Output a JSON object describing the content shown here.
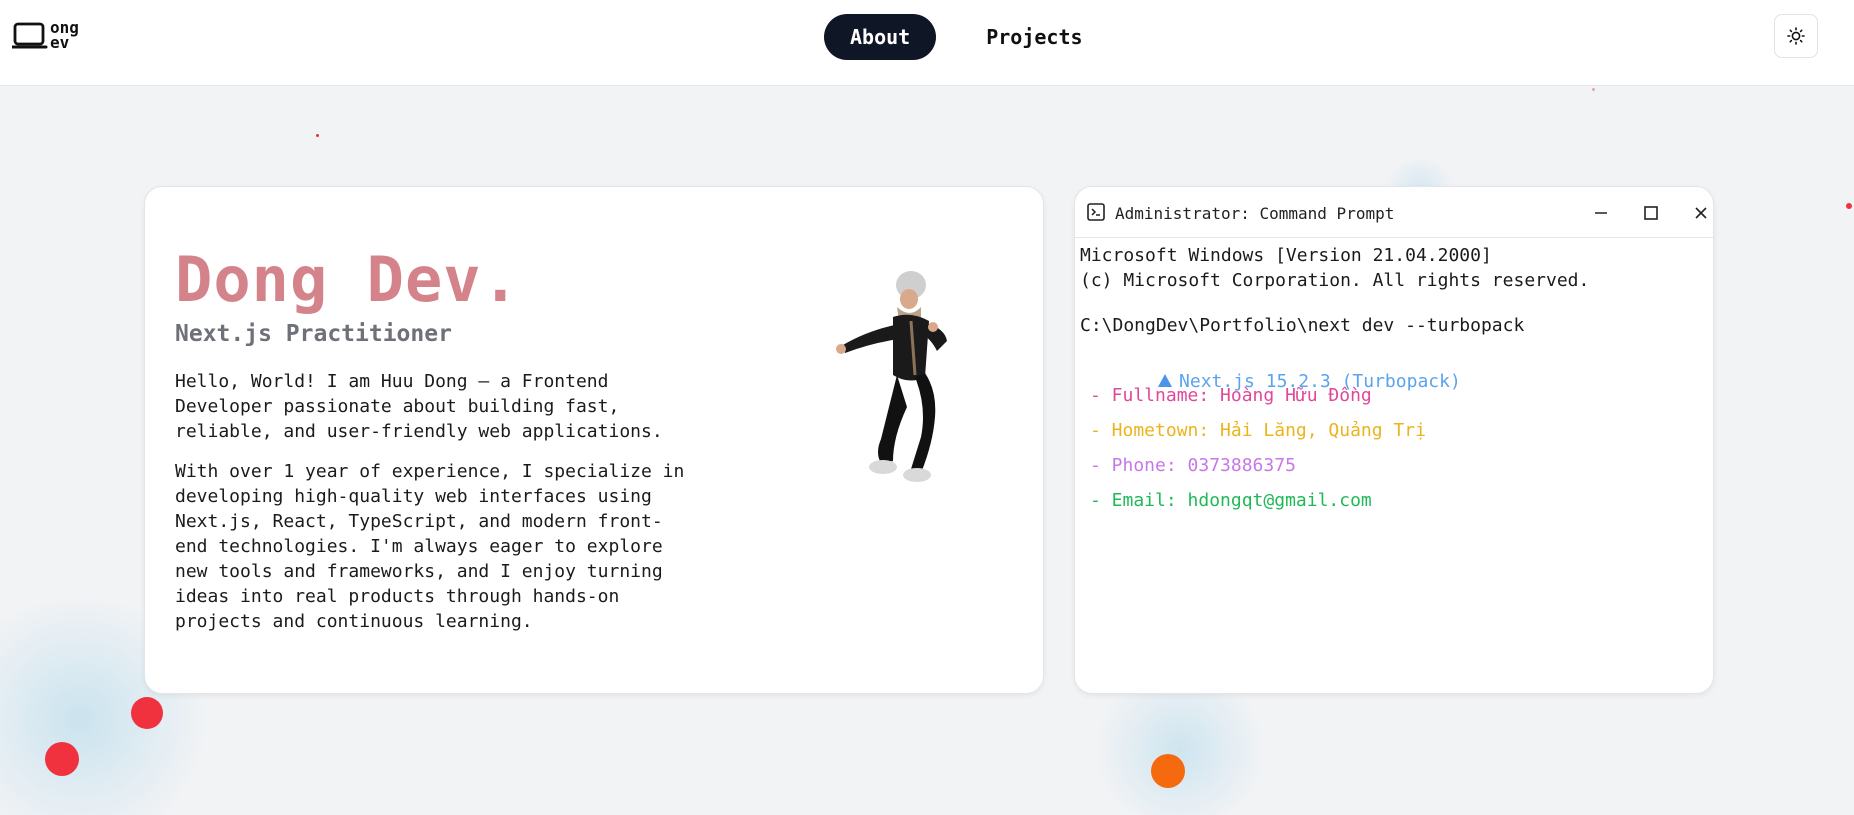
{
  "header": {
    "logo_text": "ong\nev",
    "nav": [
      {
        "label": "About",
        "active": true
      },
      {
        "label": "Projects",
        "active": false
      }
    ],
    "theme_icon": "sun-icon"
  },
  "intro": {
    "name": "Dong Dev.",
    "role": "Next.js Practitioner",
    "paragraph_1": "Hello, World! I am Huu Dong — a Frontend Developer passionate about building fast, reliable, and user-friendly web applications.",
    "paragraph_2": "With over 1 year of experience, I specialize in developing high-quality web interfaces using Next.js, React, TypeScript, and modern front-end technologies. I'm always eager to explore new tools and frameworks, and I enjoy turning ideas into real products through hands-on projects and continuous learning."
  },
  "terminal": {
    "title": "Administrator: Command Prompt",
    "lines": {
      "version": "Microsoft Windows [Version 21.04.2000]",
      "copyright": "(c) Microsoft Corporation. All rights reserved.",
      "command": "C:\\DongDev\\Portfolio\\next dev --turbopack",
      "nextjs": "Next.js 15.2.3 (Turbopack)",
      "fullname": "- Fullname: Hoàng Hữu Đồng",
      "hometown": "- Hometown: Hải Lăng, Quảng Trị",
      "phone": "- Phone: 0373886375",
      "email": "- Email: hdongqt@gmail.com"
    }
  },
  "colors": {
    "name": "#d4838a",
    "nextjs": "#5aa3ee",
    "fullname": "#e0489a",
    "hometown": "#ebb41c",
    "phone": "#c778e6",
    "email": "#1fb957",
    "nav_active_bg": "#0f1626",
    "dot_red": "#f0323f",
    "dot_orange": "#f5690f"
  }
}
